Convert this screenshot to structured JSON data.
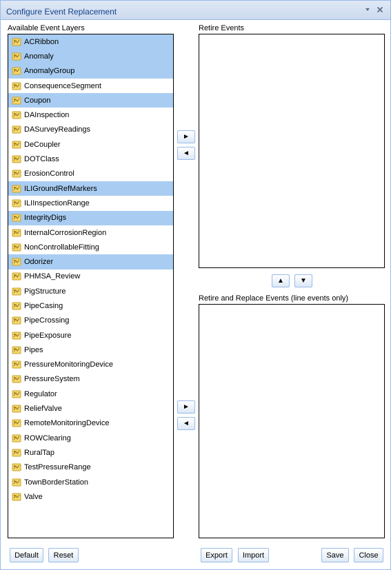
{
  "window": {
    "title": "Configure Event Replacement"
  },
  "available": {
    "label": "Available Event Layers",
    "items": [
      {
        "label": "ACRibbon",
        "selected": true
      },
      {
        "label": "Anomaly",
        "selected": true
      },
      {
        "label": "AnomalyGroup",
        "selected": true
      },
      {
        "label": "ConsequenceSegment",
        "selected": false
      },
      {
        "label": "Coupon",
        "selected": true
      },
      {
        "label": "DAInspection",
        "selected": false
      },
      {
        "label": "DASurveyReadings",
        "selected": false
      },
      {
        "label": "DeCoupler",
        "selected": false
      },
      {
        "label": "DOTClass",
        "selected": false
      },
      {
        "label": "ErosionControl",
        "selected": false
      },
      {
        "label": "ILIGroundRefMarkers",
        "selected": true
      },
      {
        "label": "ILIInspectionRange",
        "selected": false
      },
      {
        "label": "IntegrityDigs",
        "selected": true
      },
      {
        "label": "InternalCorrosionRegion",
        "selected": false
      },
      {
        "label": "NonControllableFitting",
        "selected": false
      },
      {
        "label": "Odorizer",
        "selected": true
      },
      {
        "label": "PHMSA_Review",
        "selected": false
      },
      {
        "label": "PigStructure",
        "selected": false
      },
      {
        "label": "PipeCasing",
        "selected": false
      },
      {
        "label": "PipeCrossing",
        "selected": false
      },
      {
        "label": "PipeExposure",
        "selected": false
      },
      {
        "label": "Pipes",
        "selected": false
      },
      {
        "label": "PressureMonitoringDevice",
        "selected": false
      },
      {
        "label": "PressureSystem",
        "selected": false
      },
      {
        "label": "Regulator",
        "selected": false
      },
      {
        "label": "ReliefValve",
        "selected": false
      },
      {
        "label": "RemoteMonitoringDevice",
        "selected": false
      },
      {
        "label": "ROWClearing",
        "selected": false
      },
      {
        "label": "RuralTap",
        "selected": false
      },
      {
        "label": "TestPressureRange",
        "selected": false
      },
      {
        "label": "TownBorderStation",
        "selected": false
      },
      {
        "label": "Valve",
        "selected": false
      }
    ]
  },
  "retire": {
    "label": "Retire Events"
  },
  "replace": {
    "label": "Retire and Replace Events (line events only)"
  },
  "arrows": {
    "right": "►",
    "left": "◄",
    "up": "▲",
    "down": "▼"
  },
  "buttons": {
    "default": "Default",
    "reset": "Reset",
    "export": "Export",
    "import": "Import",
    "save": "Save",
    "close": "Close"
  },
  "colors": {
    "selection": "#a9cdf2",
    "title_text": "#15428b",
    "header_bg": "#d0def0",
    "border": "#99bbe8",
    "layer_icon": "#f5d76e"
  },
  "icons": {
    "layer": "layer-icon",
    "dropdown": "chevron-down-icon",
    "close": "close-icon"
  }
}
